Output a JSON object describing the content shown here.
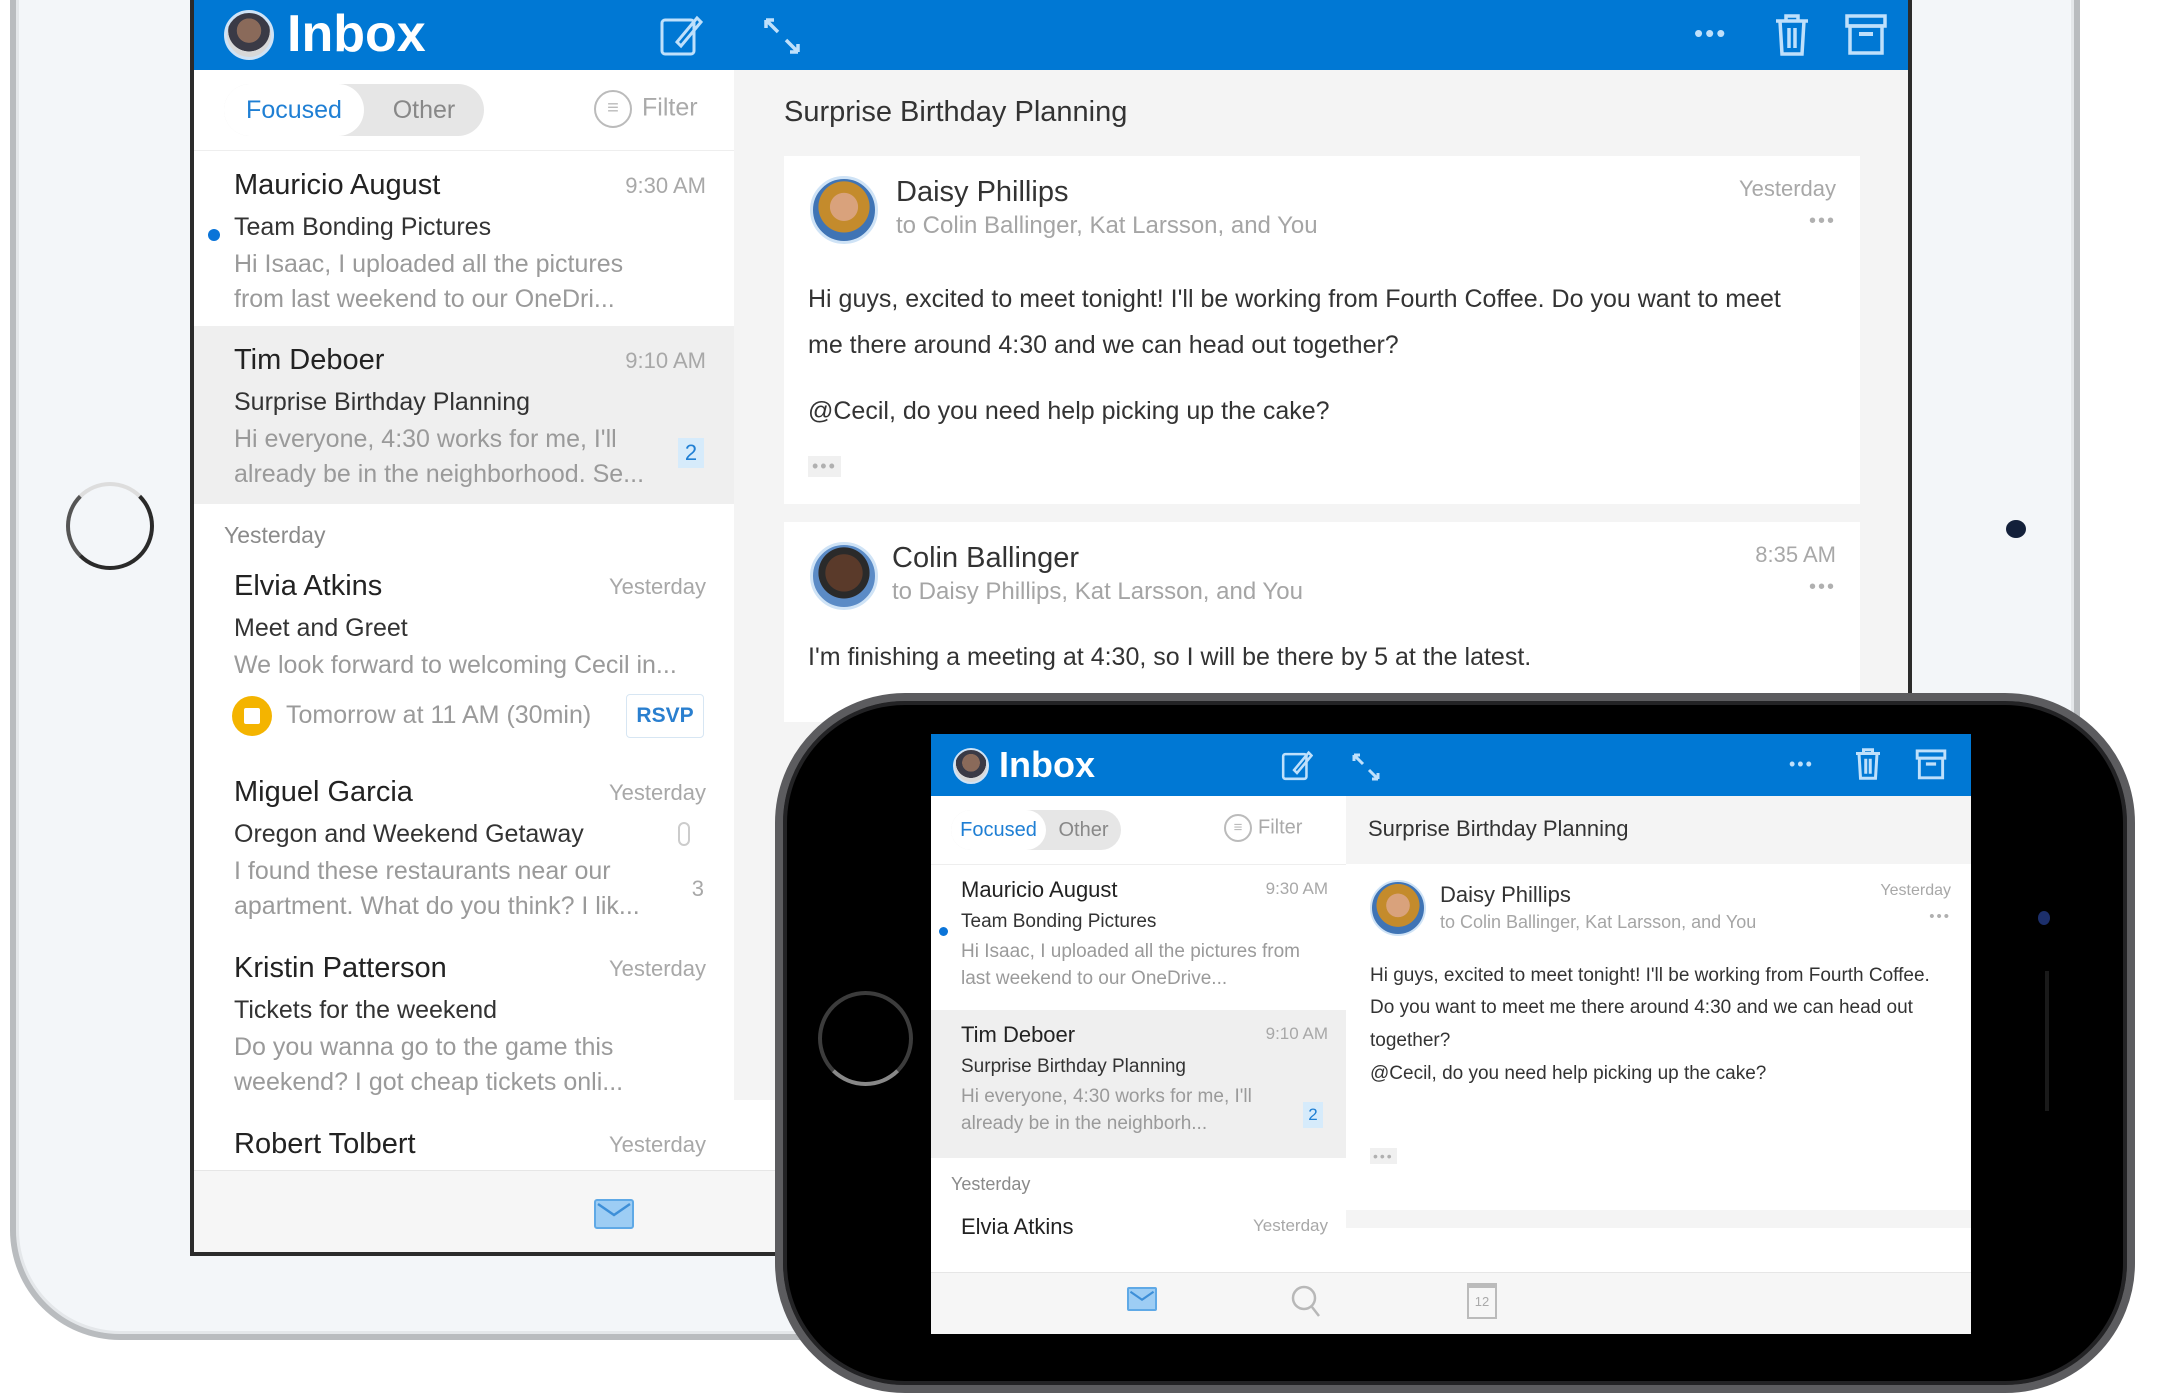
{
  "ipad": {
    "header": {
      "title": "Inbox",
      "compose_icon": "compose-icon",
      "expand_icon": "expand-icon",
      "more_icon": "more-icon",
      "trash_icon": "trash-icon",
      "archive_icon": "archive-icon",
      "more_glyph": "•••"
    },
    "tabs": {
      "focused": "Focused",
      "other": "Other"
    },
    "filter_label": "Filter",
    "conversation_title": "Surprise Birthday Planning",
    "list": [
      {
        "name": "Mauricio August",
        "time": "9:30 AM",
        "subject": "Team Bonding Pictures",
        "preview": "Hi Isaac, I uploaded all the pictures from last weekend to our OneDri...",
        "unread": true
      },
      {
        "name": "Tim Deboer",
        "time": "9:10 AM",
        "subject": "Surprise Birthday Planning",
        "preview": "Hi everyone, 4:30 works for me, I'll already be in the neighborhood. Se...",
        "count": "2",
        "selected": true
      },
      {
        "name": "Elvia Atkins",
        "time": "Yesterday",
        "subject": "Meet and Greet",
        "preview": "We look forward to welcoming Cecil in...",
        "event": "Tomorrow at 11 AM (30min)",
        "rsvp": "RSVP"
      },
      {
        "name": "Miguel Garcia",
        "time": "Yesterday",
        "subject": "Oregon and Weekend Getaway",
        "preview": "I found these restaurants near our apartment. What do you think? I lik...",
        "count": "3",
        "attachment": true
      },
      {
        "name": "Kristin Patterson",
        "time": "Yesterday",
        "subject": "Tickets for the weekend",
        "preview": "Do you wanna go to the game this weekend? I got cheap tickets onli..."
      },
      {
        "name": "Robert Tolbert",
        "time": "Yesterday"
      }
    ],
    "section_yesterday": "Yesterday",
    "messages": [
      {
        "from": "Daisy Phillips",
        "to": "to Colin Ballinger, Kat Larsson, and You",
        "time": "Yesterday",
        "body1": "Hi guys, excited to meet tonight! I'll be working from Fourth Coffee. Do you want to meet me there around 4:30 and we can head out together?",
        "body2": "@Cecil, do you need help picking up the cake?"
      },
      {
        "from": "Colin Ballinger",
        "to": "to Daisy Phillips, Kat Larsson, and You",
        "time": "8:35 AM",
        "body1": "I'm finishing a meeting at 4:30, so I will be there by 5 at the latest."
      }
    ],
    "tabbar": {
      "mail_icon": "mail-icon"
    }
  },
  "phone": {
    "header": {
      "title": "Inbox",
      "more_glyph": "•••"
    },
    "tabs": {
      "focused": "Focused",
      "other": "Other"
    },
    "filter_label": "Filter",
    "conversation_title": "Surprise Birthday Planning",
    "list": [
      {
        "name": "Mauricio August",
        "time": "9:30 AM",
        "subject": "Team Bonding Pictures",
        "preview": "Hi Isaac, I uploaded all the pictures from last weekend to our OneDrive...",
        "unread": true
      },
      {
        "name": "Tim Deboer",
        "time": "9:10 AM",
        "subject": "Surprise Birthday Planning",
        "preview": "Hi everyone, 4:30 works for me, I'll already be in the neighborh...",
        "count": "2",
        "selected": true
      },
      {
        "name": "Elvia Atkins",
        "time": "Yesterday"
      }
    ],
    "section_yesterday": "Yesterday",
    "message": {
      "from": "Daisy Phillips",
      "to": "to Colin Ballinger, Kat Larsson, and You",
      "time": "Yesterday",
      "body1": "Hi guys, excited to meet tonight! I'll be working from Fourth Coffee. Do you want to meet me there around 4:30 and we can head out together?",
      "body2": "@Cecil, do you need help picking up the cake?"
    },
    "tabbar": {
      "calendar_day": "12"
    }
  },
  "colors": {
    "accent": "#0078d4",
    "unread_dot": "#0a74d8",
    "event_dot": "#f4b400"
  }
}
